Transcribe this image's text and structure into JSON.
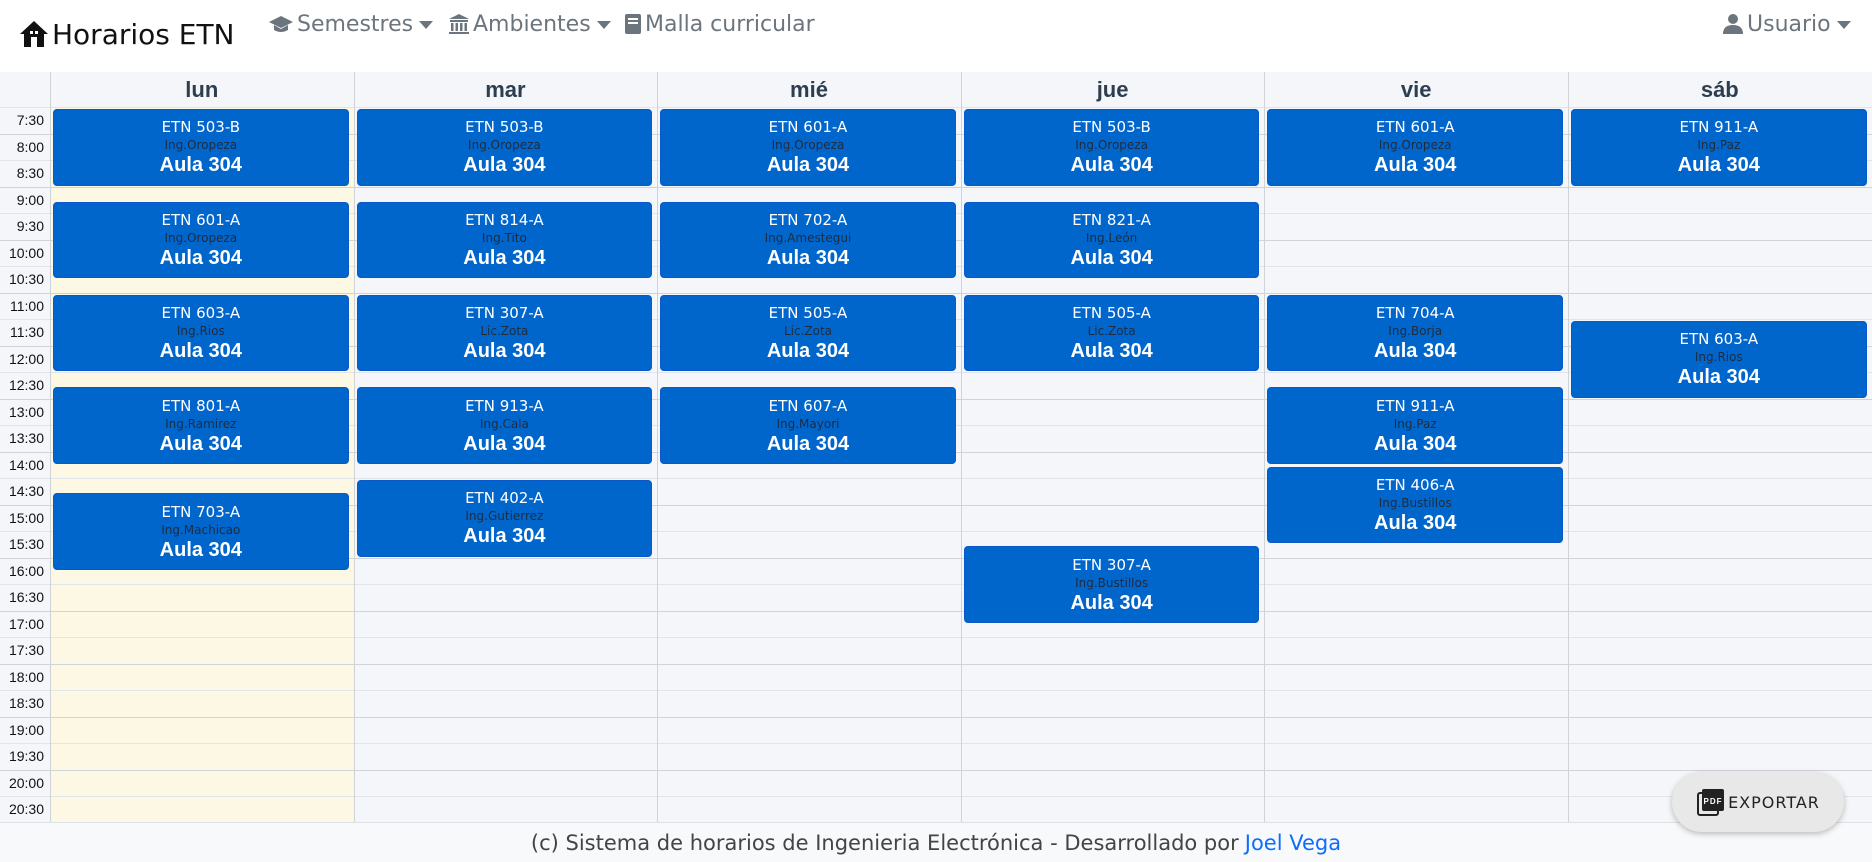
{
  "navbar": {
    "brand": "Horarios ETN",
    "semestres": "Semestres",
    "ambientes": "Ambientes",
    "malla": "Malla curricular",
    "usuario": "Usuario"
  },
  "days": [
    "lun",
    "mar",
    "mié",
    "jue",
    "vie",
    "sáb"
  ],
  "times": [
    "7:30",
    "8:00",
    "8:30",
    "9:00",
    "9:30",
    "10:00",
    "10:30",
    "11:00",
    "11:30",
    "12:00",
    "12:30",
    "13:00",
    "13:30",
    "14:00",
    "14:30",
    "15:00",
    "15:30",
    "16:00",
    "16:30",
    "17:00",
    "17:30",
    "18:00",
    "18:30",
    "19:00",
    "19:30",
    "20:00",
    "20:30"
  ],
  "events": [
    {
      "day": 0,
      "start": "7:30",
      "end": "9:00",
      "code": "ETN 503-B",
      "prof": "Ing.Oropeza",
      "room": "Aula 304"
    },
    {
      "day": 0,
      "start": "9:15",
      "end": "10:45",
      "code": "ETN 601-A",
      "prof": "Ing.Oropeza",
      "room": "Aula 304"
    },
    {
      "day": 0,
      "start": "11:00",
      "end": "12:30",
      "code": "ETN 603-A",
      "prof": "Ing.Rios",
      "room": "Aula 304"
    },
    {
      "day": 0,
      "start": "12:45",
      "end": "14:15",
      "code": "ETN 801-A",
      "prof": "Ing.Ramirez",
      "room": "Aula 304"
    },
    {
      "day": 0,
      "start": "14:45",
      "end": "16:15",
      "code": "ETN 703-A",
      "prof": "Ing.Machicao",
      "room": "Aula 304"
    },
    {
      "day": 1,
      "start": "7:30",
      "end": "9:00",
      "code": "ETN 503-B",
      "prof": "Ing.Oropeza",
      "room": "Aula 304"
    },
    {
      "day": 1,
      "start": "9:15",
      "end": "10:45",
      "code": "ETN 814-A",
      "prof": "Ing.Tito",
      "room": "Aula 304"
    },
    {
      "day": 1,
      "start": "11:00",
      "end": "12:30",
      "code": "ETN 307-A",
      "prof": "Lic.Zota",
      "room": "Aula 304"
    },
    {
      "day": 1,
      "start": "12:45",
      "end": "14:15",
      "code": "ETN 913-A",
      "prof": "Ing.Cala",
      "room": "Aula 304"
    },
    {
      "day": 1,
      "start": "14:30",
      "end": "16:00",
      "code": "ETN 402-A",
      "prof": "Ing.Gutierrez",
      "room": "Aula 304"
    },
    {
      "day": 2,
      "start": "7:30",
      "end": "9:00",
      "code": "ETN 601-A",
      "prof": "Ing.Oropeza",
      "room": "Aula 304"
    },
    {
      "day": 2,
      "start": "9:15",
      "end": "10:45",
      "code": "ETN 702-A",
      "prof": "Ing.Amestegui",
      "room": "Aula 304"
    },
    {
      "day": 2,
      "start": "11:00",
      "end": "12:30",
      "code": "ETN 505-A",
      "prof": "Lic.Zota",
      "room": "Aula 304"
    },
    {
      "day": 2,
      "start": "12:45",
      "end": "14:15",
      "code": "ETN 607-A",
      "prof": "Ing.Mayori",
      "room": "Aula 304"
    },
    {
      "day": 3,
      "start": "7:30",
      "end": "9:00",
      "code": "ETN 503-B",
      "prof": "Ing.Oropeza",
      "room": "Aula 304"
    },
    {
      "day": 3,
      "start": "9:15",
      "end": "10:45",
      "code": "ETN 821-A",
      "prof": "Ing.León",
      "room": "Aula 304"
    },
    {
      "day": 3,
      "start": "11:00",
      "end": "12:30",
      "code": "ETN 505-A",
      "prof": "Lic.Zota",
      "room": "Aula 304"
    },
    {
      "day": 3,
      "start": "15:45",
      "end": "17:15",
      "code": "ETN 307-A",
      "prof": "Ing.Bustillos",
      "room": "Aula 304"
    },
    {
      "day": 4,
      "start": "7:30",
      "end": "9:00",
      "code": "ETN 601-A",
      "prof": "Ing.Oropeza",
      "room": "Aula 304"
    },
    {
      "day": 4,
      "start": "11:00",
      "end": "12:30",
      "code": "ETN 704-A",
      "prof": "Ing.Borja",
      "room": "Aula 304"
    },
    {
      "day": 4,
      "start": "12:45",
      "end": "14:15",
      "code": "ETN 911-A",
      "prof": "Ing.Paz",
      "room": "Aula 304"
    },
    {
      "day": 4,
      "start": "14:15",
      "end": "15:45",
      "code": "ETN 406-A",
      "prof": "Ing.Bustillos",
      "room": "Aula 304"
    },
    {
      "day": 5,
      "start": "7:30",
      "end": "9:00",
      "code": "ETN 911-A",
      "prof": "Ing.Paz",
      "room": "Aula 304"
    },
    {
      "day": 5,
      "start": "11:30",
      "end": "13:00",
      "code": "ETN 603-A",
      "prof": "Ing.Rios",
      "room": "Aula 304"
    }
  ],
  "footer": {
    "text": "(c) Sistema de horarios de Ingenieria Electrónica - Desarrollado por",
    "author": "Joel Vega"
  },
  "export_label": "EXPORTAR",
  "colors": {
    "event_bg": "#0066cc",
    "today_bg": "#fcf8e3",
    "link": "#0d6efd"
  }
}
